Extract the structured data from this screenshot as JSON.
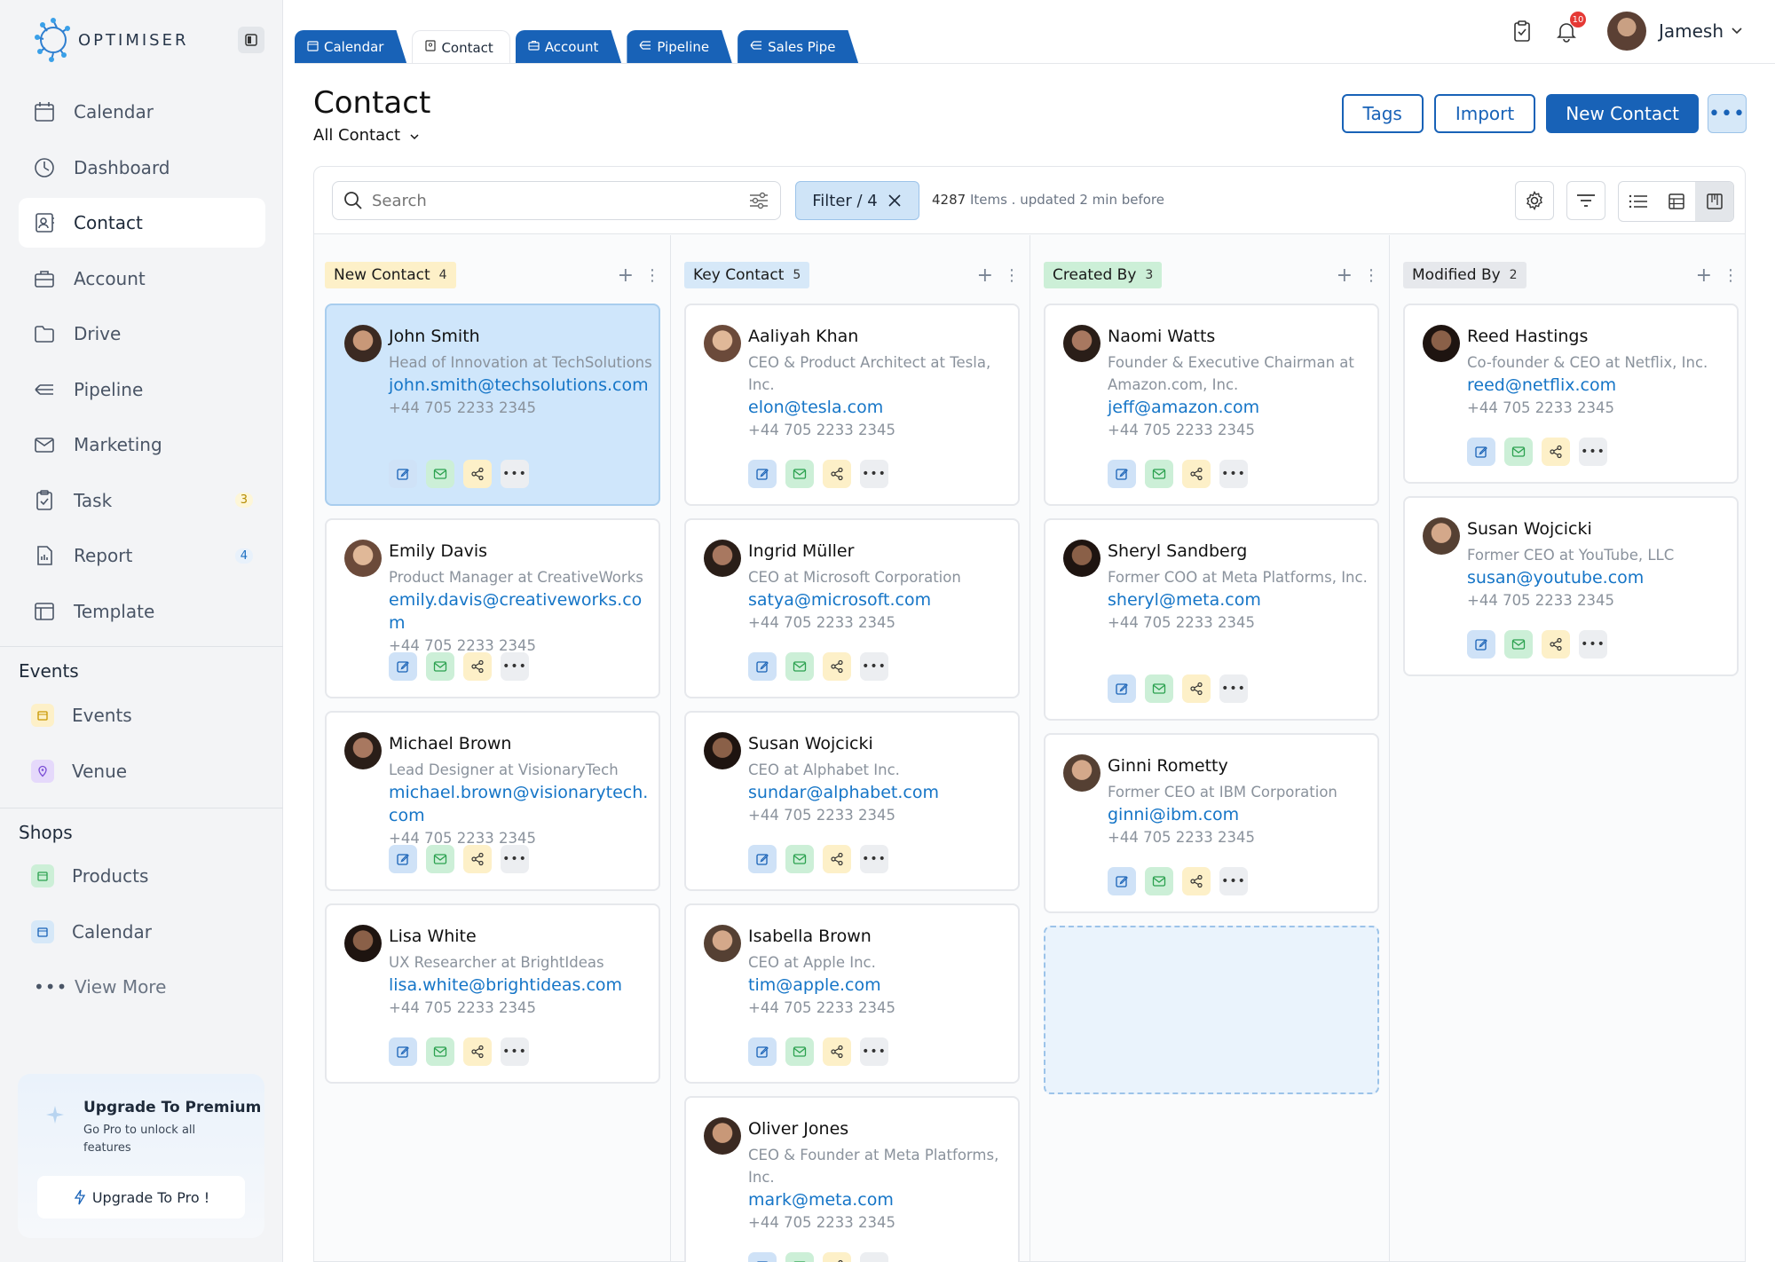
{
  "app": {
    "logo_text": "OPTIMISER"
  },
  "sidebar": {
    "items": [
      {
        "label": "Calendar",
        "icon": "calendar-icon"
      },
      {
        "label": "Dashboard",
        "icon": "dashboard-icon"
      },
      {
        "label": "Contact",
        "icon": "contact-icon",
        "active": true
      },
      {
        "label": "Account",
        "icon": "account-icon"
      },
      {
        "label": "Drive",
        "icon": "folder-icon"
      },
      {
        "label": "Pipeline",
        "icon": "pipeline-icon"
      },
      {
        "label": "Marketing",
        "icon": "mail-icon"
      },
      {
        "label": "Task",
        "icon": "task-icon",
        "badge": "3"
      },
      {
        "label": "Report",
        "icon": "report-icon",
        "badge": "4"
      },
      {
        "label": "Template",
        "icon": "template-icon"
      }
    ],
    "events_title": "Events",
    "events": [
      {
        "label": "Events"
      },
      {
        "label": "Venue"
      }
    ],
    "shops_title": "Shops",
    "shops": [
      {
        "label": "Products"
      },
      {
        "label": "Calendar"
      }
    ],
    "view_more": "View More",
    "upgrade": {
      "title": "Upgrade To Premium",
      "subtitle": "Go Pro to unlock all features",
      "button": "Upgrade  To Pro !"
    }
  },
  "tabs": [
    {
      "label": "Calendar",
      "icon": "calendar-icon"
    },
    {
      "label": "Contact",
      "icon": "contact-icon",
      "active": true
    },
    {
      "label": "Account",
      "icon": "account-icon"
    },
    {
      "label": "Pipeline",
      "icon": "pipeline-icon"
    },
    {
      "label": "Sales Pipe",
      "icon": "pipeline-icon"
    }
  ],
  "topbar": {
    "notification_count": "10",
    "user_name": "Jamesh"
  },
  "header": {
    "title": "Contact",
    "view_selector": "All Contact",
    "buttons": {
      "tags": "Tags",
      "import": "Import",
      "new_contact": "New Contact"
    }
  },
  "toolbar": {
    "search_placeholder": "Search",
    "filter_label": "Filter / 4",
    "items_count": "4287",
    "items_suffix": " Items . updated 2 min before"
  },
  "columns": [
    {
      "title": "New Contact",
      "count": "4",
      "color": "#fdf0c8",
      "cards": [
        {
          "name": "John Smith",
          "role": "Head of Innovation at TechSolutions",
          "email": "john.smith@techsolutions.com",
          "phone": "+44 705 2233 2345",
          "selected": true
        },
        {
          "name": "Emily Davis",
          "role": "Product Manager at CreativeWorks",
          "email": "emily.davis@creativeworks.com",
          "phone": "+44 705 2233 2345"
        },
        {
          "name": "Michael Brown",
          "role": "Lead Designer at VisionaryTech",
          "email": "michael.brown@visionarytech.com",
          "phone": "+44 705 2233 2345"
        },
        {
          "name": "Lisa White",
          "role": "UX Researcher at BrightIdeas",
          "email": "lisa.white@brightideas.com",
          "phone": "+44 705 2233 2345"
        }
      ]
    },
    {
      "title": "Key Contact",
      "count": "5",
      "color": "#d6e8f8",
      "cards": [
        {
          "name": "Aaliyah Khan",
          "role": "CEO & Product Architect at Tesla, Inc.",
          "email": "elon@tesla.com",
          "phone": "+44 705 2233 2345"
        },
        {
          "name": "Ingrid Müller",
          "role": "CEO at Microsoft Corporation",
          "email": "satya@microsoft.com",
          "phone": "+44 705 2233 2345"
        },
        {
          "name": "Susan Wojcicki",
          "role": "CEO at Alphabet Inc.",
          "email": "sundar@alphabet.com",
          "phone": "+44 705 2233 2345"
        },
        {
          "name": "Isabella Brown",
          "role": "CEO at Apple Inc.",
          "email": "tim@apple.com",
          "phone": "+44 705 2233 2345"
        },
        {
          "name": "Oliver Jones",
          "role": "CEO & Founder at Meta Platforms, Inc.",
          "email": "mark@meta.com",
          "phone": "+44 705 2233 2345"
        }
      ]
    },
    {
      "title": "Created By",
      "count": "3",
      "color": "#ccefd7",
      "cards": [
        {
          "name": "Naomi Watts",
          "role": "Founder & Executive Chairman at Amazon.com, Inc.",
          "email": "jeff@amazon.com",
          "phone": "+44 705 2233 2345"
        },
        {
          "name": "Sheryl Sandberg",
          "role": "Former COO at Meta Platforms, Inc.",
          "email": "sheryl@meta.com",
          "phone": "+44 705 2233 2345"
        },
        {
          "name": "Ginni Rometty",
          "role": "Former CEO at IBM Corporation",
          "email": "ginni@ibm.com",
          "phone": "+44 705 2233 2345"
        }
      ]
    },
    {
      "title": "Modified By",
      "count": "2",
      "color": "#e6e8ec",
      "cards": [
        {
          "name": "Reed Hastings",
          "role": "Co-founder & CEO at Netflix, Inc.",
          "email": "reed@netflix.com",
          "phone": "+44 705 2233 2345"
        },
        {
          "name": "Susan Wojcicki",
          "role": "Former CEO at YouTube, LLC",
          "email": "susan@youtube.com",
          "phone": "+44 705 2233 2345"
        }
      ]
    }
  ]
}
